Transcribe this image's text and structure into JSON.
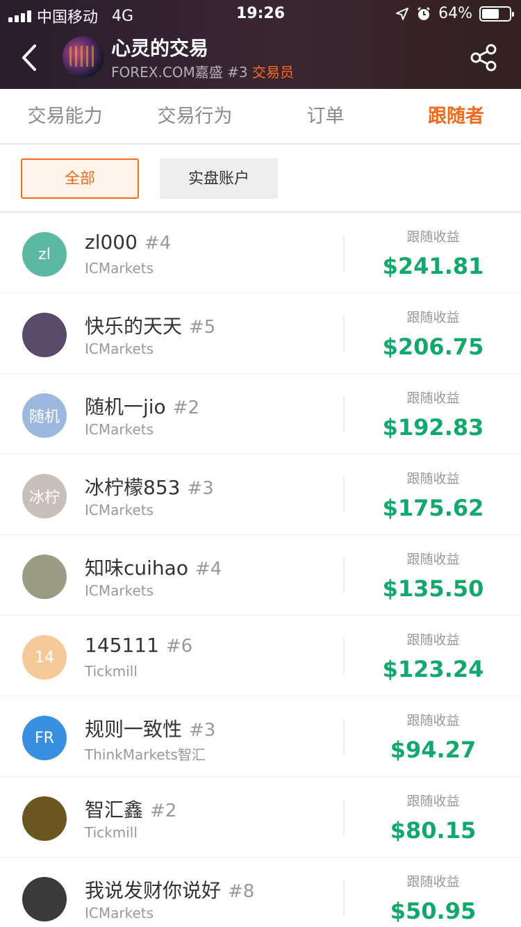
{
  "status_bar": {
    "carrier": "中国移动",
    "network": "4G",
    "time": "19:26",
    "battery": "64%",
    "battery_level": 0.64
  },
  "header": {
    "title": "心灵的交易",
    "broker": "FOREX.COM嘉盛",
    "rank": "#3",
    "role": "交易员",
    "back_icon": "chevron-left-icon",
    "share_icon": "share-icon"
  },
  "tabs": [
    {
      "label": "交易能力",
      "active": false
    },
    {
      "label": "交易行为",
      "active": false
    },
    {
      "label": "订单",
      "active": false
    },
    {
      "label": "跟随者",
      "active": true
    }
  ],
  "filters": {
    "all": "全部",
    "live_account": "实盘账户"
  },
  "profit_label": "跟随收益",
  "followers": [
    {
      "name": "zl000",
      "rank": "#4",
      "broker": "ICMarkets",
      "profit": "$241.81",
      "avatar_text": "zl",
      "avatar_color": "#5bb8a2"
    },
    {
      "name": "快乐的天天",
      "rank": "#5",
      "broker": "ICMarkets",
      "profit": "$206.75",
      "avatar_text": "",
      "avatar_color": "#5a4a6a"
    },
    {
      "name": "随机一jio",
      "rank": "#2",
      "broker": "ICMarkets",
      "profit": "$192.83",
      "avatar_text": "随机",
      "avatar_color": "#9db8de"
    },
    {
      "name": "冰柠檬853",
      "rank": "#3",
      "broker": "ICMarkets",
      "profit": "$175.62",
      "avatar_text": "冰柠",
      "avatar_color": "#c9bfb9"
    },
    {
      "name": "知味cuihao",
      "rank": "#4",
      "broker": "ICMarkets",
      "profit": "$135.50",
      "avatar_text": "",
      "avatar_color": "#9a9c84"
    },
    {
      "name": "145111",
      "rank": "#6",
      "broker": "Tickmill",
      "profit": "$123.24",
      "avatar_text": "14",
      "avatar_color": "#f7c999"
    },
    {
      "name": "规则一致性",
      "rank": "#3",
      "broker": "ThinkMarkets智汇",
      "profit": "$94.27",
      "avatar_text": "FR",
      "avatar_color": "#3a90e0"
    },
    {
      "name": "智汇鑫",
      "rank": "#2",
      "broker": "Tickmill",
      "profit": "$80.15",
      "avatar_text": "",
      "avatar_color": "#6b5520"
    },
    {
      "name": "我说发财你说好",
      "rank": "#8",
      "broker": "ICMarkets",
      "profit": "$50.95",
      "avatar_text": "",
      "avatar_color": "#3a3a3a"
    }
  ]
}
